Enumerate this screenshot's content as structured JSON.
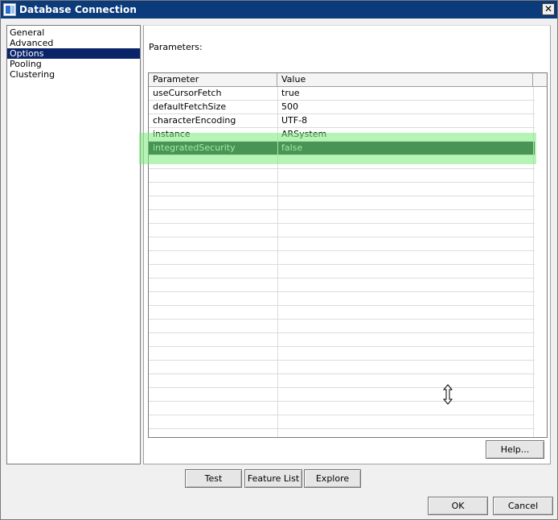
{
  "window": {
    "title": "Database Connection",
    "close_symbol": "✕"
  },
  "nav": {
    "items": [
      {
        "label": "General",
        "selected": false
      },
      {
        "label": "Advanced",
        "selected": false
      },
      {
        "label": "Options",
        "selected": true
      },
      {
        "label": "Pooling",
        "selected": false
      },
      {
        "label": "Clustering",
        "selected": false
      }
    ]
  },
  "options": {
    "parameters_label": "Parameters:",
    "columns": [
      "Parameter",
      "Value"
    ],
    "rows": [
      {
        "parameter": "useCursorFetch",
        "value": "true"
      },
      {
        "parameter": "defaultFetchSize",
        "value": "500"
      },
      {
        "parameter": "characterEncoding",
        "value": "UTF-8"
      },
      {
        "parameter": "instance",
        "value": "ARSystem"
      },
      {
        "parameter": "integratedSecurity",
        "value": "false"
      }
    ],
    "selected_row": 4,
    "help_label": "Help..."
  },
  "actions": {
    "test_label": "Test",
    "feature_list_label": "Feature List",
    "explore_label": "Explore",
    "ok_label": "OK",
    "cancel_label": "Cancel"
  },
  "colors": {
    "titlebar": "#0b3b7a",
    "selection": "#0a246a",
    "row_highlight": "#78eb78"
  },
  "icons": {
    "cursor": "resize-vertical-cursor-icon",
    "app": "database-window-icon"
  }
}
